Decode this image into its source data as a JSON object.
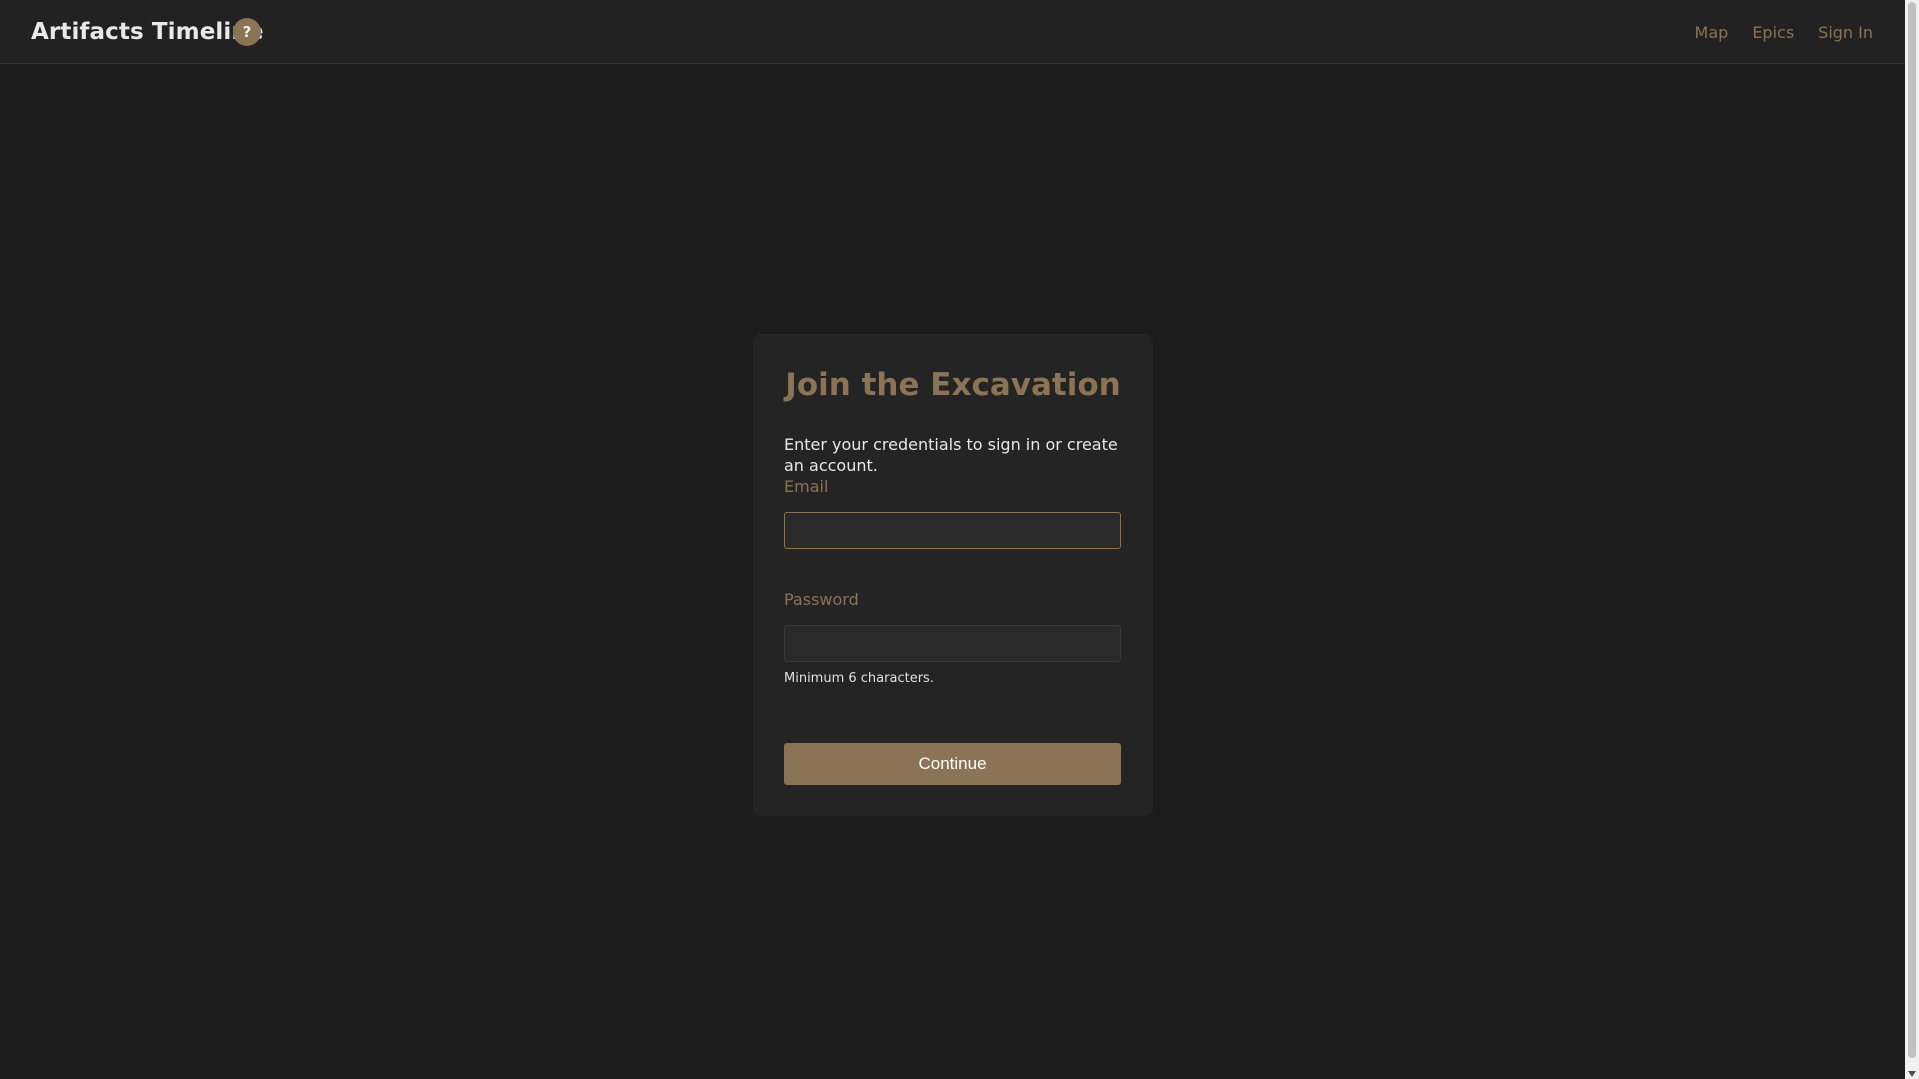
{
  "header": {
    "brand": "Artifacts Timeline",
    "help_glyph": "?",
    "nav": [
      {
        "label": "Map"
      },
      {
        "label": "Epics"
      },
      {
        "label": "Sign In"
      }
    ]
  },
  "auth_card": {
    "title": "Join the Excavation",
    "intro": "Enter your credentials to sign in or create an account.",
    "email_label": "Email",
    "email_value": "",
    "password_label": "Password",
    "password_value": "",
    "password_hint": "Minimum 6 characters.",
    "submit_label": "Continue"
  },
  "theme": {
    "background": "#1c1c1c",
    "header_background": "#222222",
    "card_background": "#242424",
    "accent": "#8b7355",
    "text": "#e8e8e8"
  },
  "icons": {
    "help": "question-mark-circle-icon"
  }
}
